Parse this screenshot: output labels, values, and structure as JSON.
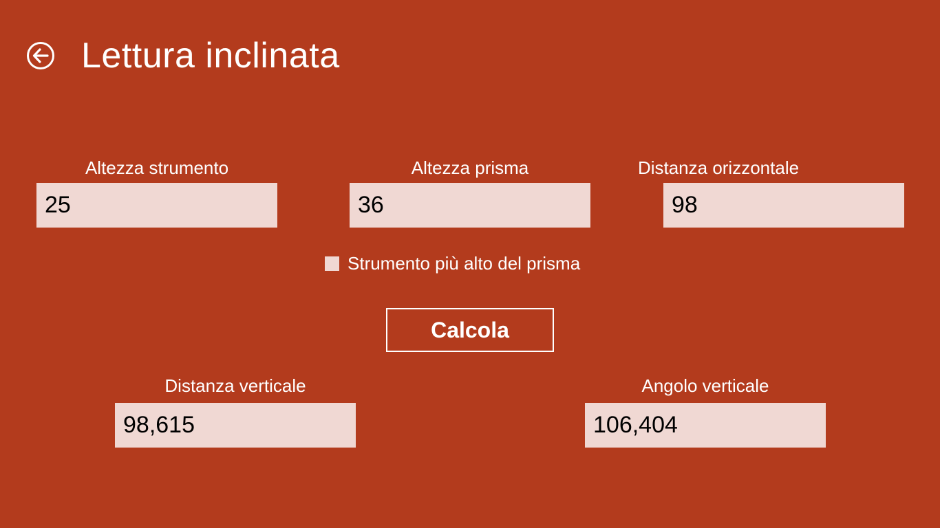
{
  "header": {
    "back_icon": "back-arrow-circle-icon",
    "title": "Lettura inclinata"
  },
  "inputs": {
    "altezza_strumento": {
      "label": "Altezza strumento",
      "value": "25"
    },
    "altezza_prisma": {
      "label": "Altezza prisma",
      "value": "36"
    },
    "distanza_orizzontale": {
      "label": "Distanza orizzontale",
      "value": "98"
    }
  },
  "checkbox": {
    "label": "Strumento più alto del prisma",
    "checked": false
  },
  "actions": {
    "calculate_label": "Calcola"
  },
  "outputs": {
    "distanza_verticale": {
      "label": "Distanza verticale",
      "value": "98,615"
    },
    "angolo_verticale": {
      "label": "Angolo verticale",
      "value": "106,404"
    }
  },
  "colors": {
    "background": "#b33b1d",
    "field_background": "#f0d8d3",
    "text": "#ffffff"
  }
}
